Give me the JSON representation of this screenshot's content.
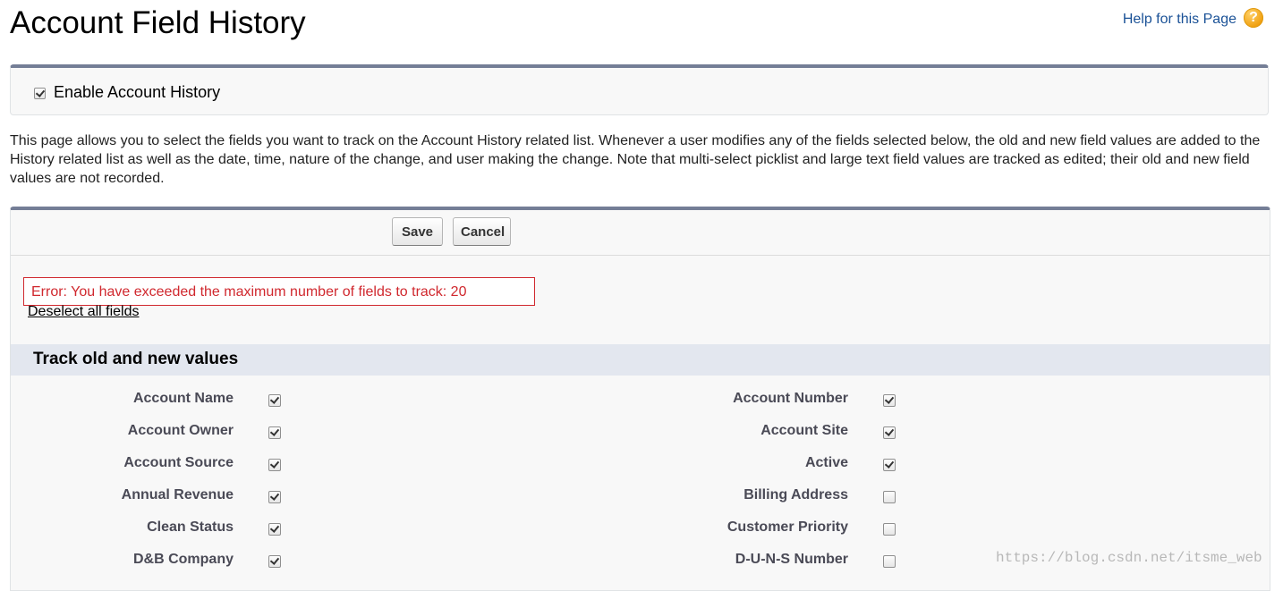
{
  "page": {
    "title": "Account Field History",
    "help_link": "Help for this Page",
    "help_icon": "?"
  },
  "enable": {
    "label": "Enable Account History",
    "checked": true
  },
  "description": "This page allows you to select the fields you want to track on the Account History related list. Whenever a user modifies any of the fields selected below, the old and new field values are added to the History related list as well as the date, time, nature of the change, and user making the change. Note that multi-select picklist and large text field values are tracked as edited; their old and new field values are not recorded.",
  "buttons": {
    "save": "Save",
    "cancel": "Cancel"
  },
  "error": "Error: You have exceeded the maximum number of fields to track: 20",
  "deselect_all": "Deselect all fields",
  "section": {
    "title": "Track old and new values"
  },
  "fields": {
    "left": [
      {
        "label": "Account Name",
        "checked": true
      },
      {
        "label": "Account Owner",
        "checked": true
      },
      {
        "label": "Account Source",
        "checked": true
      },
      {
        "label": "Annual Revenue",
        "checked": true
      },
      {
        "label": "Clean Status",
        "checked": true
      },
      {
        "label": "D&B Company",
        "checked": true
      }
    ],
    "right": [
      {
        "label": "Account Number",
        "checked": true
      },
      {
        "label": "Account Site",
        "checked": true
      },
      {
        "label": "Active",
        "checked": true
      },
      {
        "label": "Billing Address",
        "checked": false
      },
      {
        "label": "Customer Priority",
        "checked": false
      },
      {
        "label": "D-U-N-S Number",
        "checked": false
      }
    ]
  },
  "watermark": "https://blog.csdn.net/itsme_web"
}
